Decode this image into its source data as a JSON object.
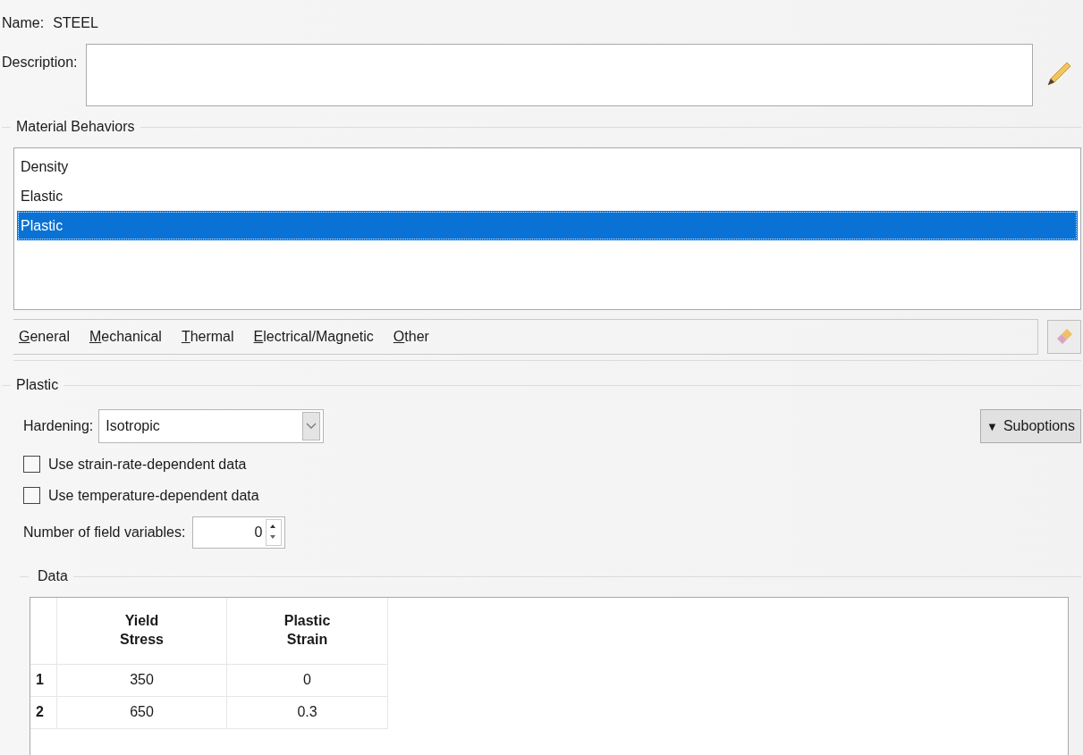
{
  "name": {
    "label": "Name:",
    "value": "STEEL"
  },
  "description": {
    "label": "Description:"
  },
  "behaviors": {
    "title": "Material Behaviors",
    "items": [
      {
        "label": "Density",
        "selected": false
      },
      {
        "label": "Elastic",
        "selected": false
      },
      {
        "label": "Plastic",
        "selected": true
      }
    ]
  },
  "menu": [
    "General",
    "Mechanical",
    "Thermal",
    "Electrical/Magnetic",
    "Other"
  ],
  "plastic": {
    "title": "Plastic",
    "hardening_label": "Hardening:",
    "hardening_value": "Isotropic",
    "suboptions": "Suboptions",
    "suboptions_glyph": "▼",
    "checkboxes": [
      {
        "label": "Use strain-rate-dependent data",
        "checked": false
      },
      {
        "label": "Use temperature-dependent data",
        "checked": false
      }
    ],
    "field_variables_label": "Number of field variables:",
    "field_variables_value": "0"
  },
  "data": {
    "title": "Data",
    "columns": [
      "Yield\nStress",
      "Plastic\nStrain"
    ],
    "rows": [
      {
        "index": "1",
        "cells": [
          "350",
          "0"
        ]
      },
      {
        "index": "2",
        "cells": [
          "650",
          "0.3"
        ]
      }
    ]
  }
}
